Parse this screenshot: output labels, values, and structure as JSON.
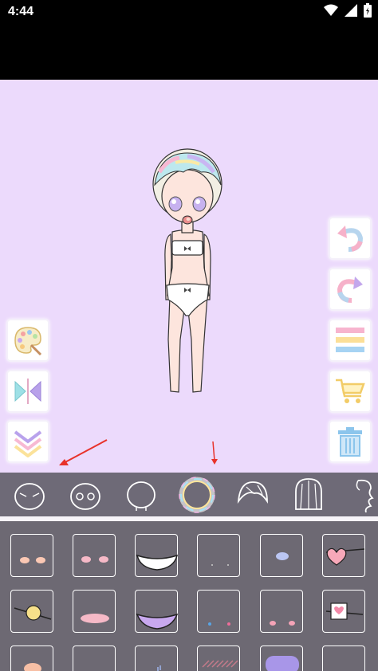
{
  "status_bar": {
    "time": "4:44",
    "icons": [
      "wifi-icon",
      "signal-icon",
      "battery-icon"
    ]
  },
  "stage": {
    "background": "#ecdafc"
  },
  "left_tools": [
    {
      "name": "palette-button",
      "icon": "palette-icon"
    },
    {
      "name": "flip-button",
      "icon": "mirror-flip-icon"
    },
    {
      "name": "collapse-button",
      "icon": "chevron-down-icon"
    }
  ],
  "right_tools": [
    {
      "name": "undo-button",
      "icon": "undo-icon"
    },
    {
      "name": "redo-button",
      "icon": "redo-icon"
    },
    {
      "name": "layers-button",
      "icon": "layers-icon"
    },
    {
      "name": "shop-button",
      "icon": "cart-icon"
    },
    {
      "name": "delete-button",
      "icon": "trash-icon"
    }
  ],
  "categories": [
    {
      "name": "face-category",
      "icon": "face-outline-icon"
    },
    {
      "name": "eyes-category",
      "icon": "eyes-icon"
    },
    {
      "name": "head-category",
      "icon": "head-icon"
    },
    {
      "name": "halo-category",
      "icon": "halo-icon",
      "selected": true
    },
    {
      "name": "bangs-category",
      "icon": "bangs-icon"
    },
    {
      "name": "hair-category",
      "icon": "hair-icon"
    },
    {
      "name": "ponytail-category",
      "icon": "ponytail-icon"
    }
  ],
  "items": [
    {
      "name": "item-pink-blush"
    },
    {
      "name": "item-light-blush"
    },
    {
      "name": "item-mask"
    },
    {
      "name": "item-tiny-dots"
    },
    {
      "name": "item-blue-oval"
    },
    {
      "name": "item-heart-patch"
    },
    {
      "name": "item-yellow-pin"
    },
    {
      "name": "item-pink-lips"
    },
    {
      "name": "item-purple-mask"
    },
    {
      "name": "item-color-dots"
    },
    {
      "name": "item-pink-dots"
    },
    {
      "name": "item-bandage"
    },
    {
      "name": "item-peach-blob"
    },
    {
      "name": "item-blank"
    },
    {
      "name": "item-stripes"
    },
    {
      "name": "item-lines"
    },
    {
      "name": "item-lilac-blob"
    },
    {
      "name": "item-blank-2"
    }
  ]
}
